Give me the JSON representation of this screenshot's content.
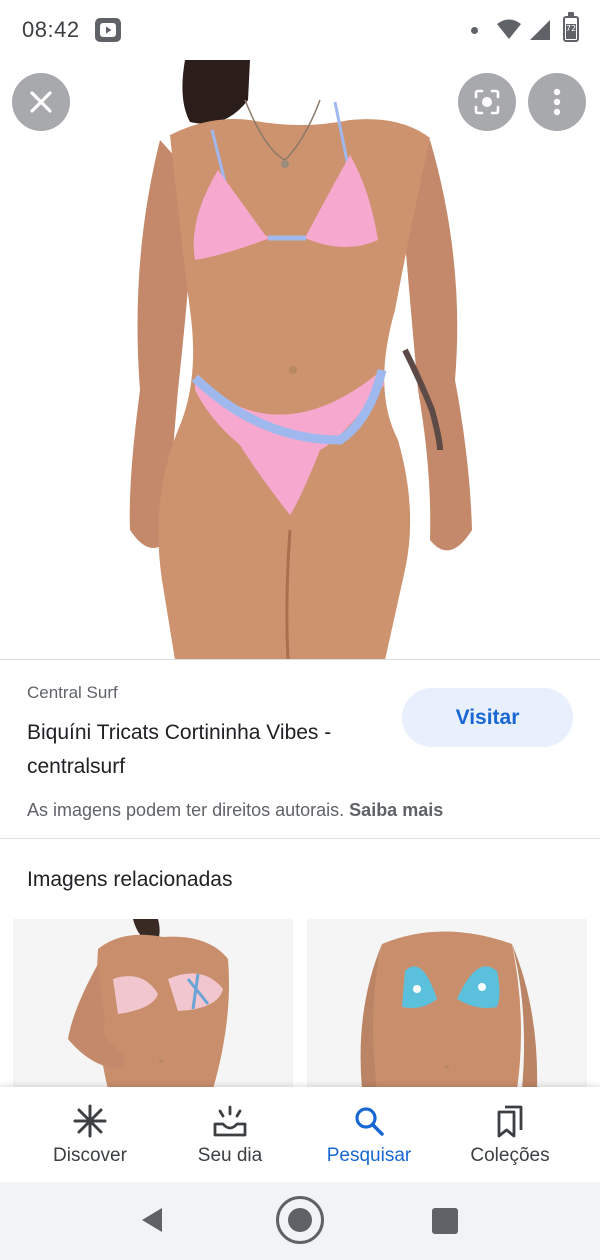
{
  "status_bar": {
    "time": "08:42",
    "battery_level": "72",
    "icons": [
      "youtube-app-icon",
      "notification-dot-icon",
      "wifi-icon",
      "cell-signal-icon",
      "battery-icon"
    ]
  },
  "image_viewer": {
    "main_image": "pink-bikini-product-photo",
    "close_icon": "close-icon",
    "lens_icon": "google-lens-icon",
    "more_icon": "more-vert-icon"
  },
  "result": {
    "source": "Central Surf",
    "title": "Biquíni Tricats Cortininha Vibes - centralsurf",
    "visit_label": "Visitar",
    "copyright_text": "As imagens podem ter direitos autorais.",
    "copyright_link": "Saiba mais"
  },
  "related": {
    "heading": "Imagens relacionadas",
    "items": [
      {
        "image": "pink-floral-bikini-photo"
      },
      {
        "image": "blue-floral-bikini-photo"
      }
    ]
  },
  "bottom_nav": {
    "items": [
      {
        "label": "Discover",
        "icon": "asterisk-icon",
        "active": false
      },
      {
        "label": "Seu dia",
        "icon": "sunrise-icon",
        "active": false
      },
      {
        "label": "Pesquisar",
        "icon": "search-icon",
        "active": true
      },
      {
        "label": "Coleções",
        "icon": "bookmarks-icon",
        "active": false
      }
    ]
  },
  "colors": {
    "accent": "#1967d2",
    "visit_button_bg": "#e8f0fe",
    "secondary_text": "#5f6368",
    "bikini_pink": "#f7a8cf",
    "bikini_trim": "#9fb8ee",
    "skin": "#c98f6c"
  },
  "system_nav": {
    "icons": [
      "back-icon",
      "home-icon",
      "recents-icon"
    ]
  }
}
